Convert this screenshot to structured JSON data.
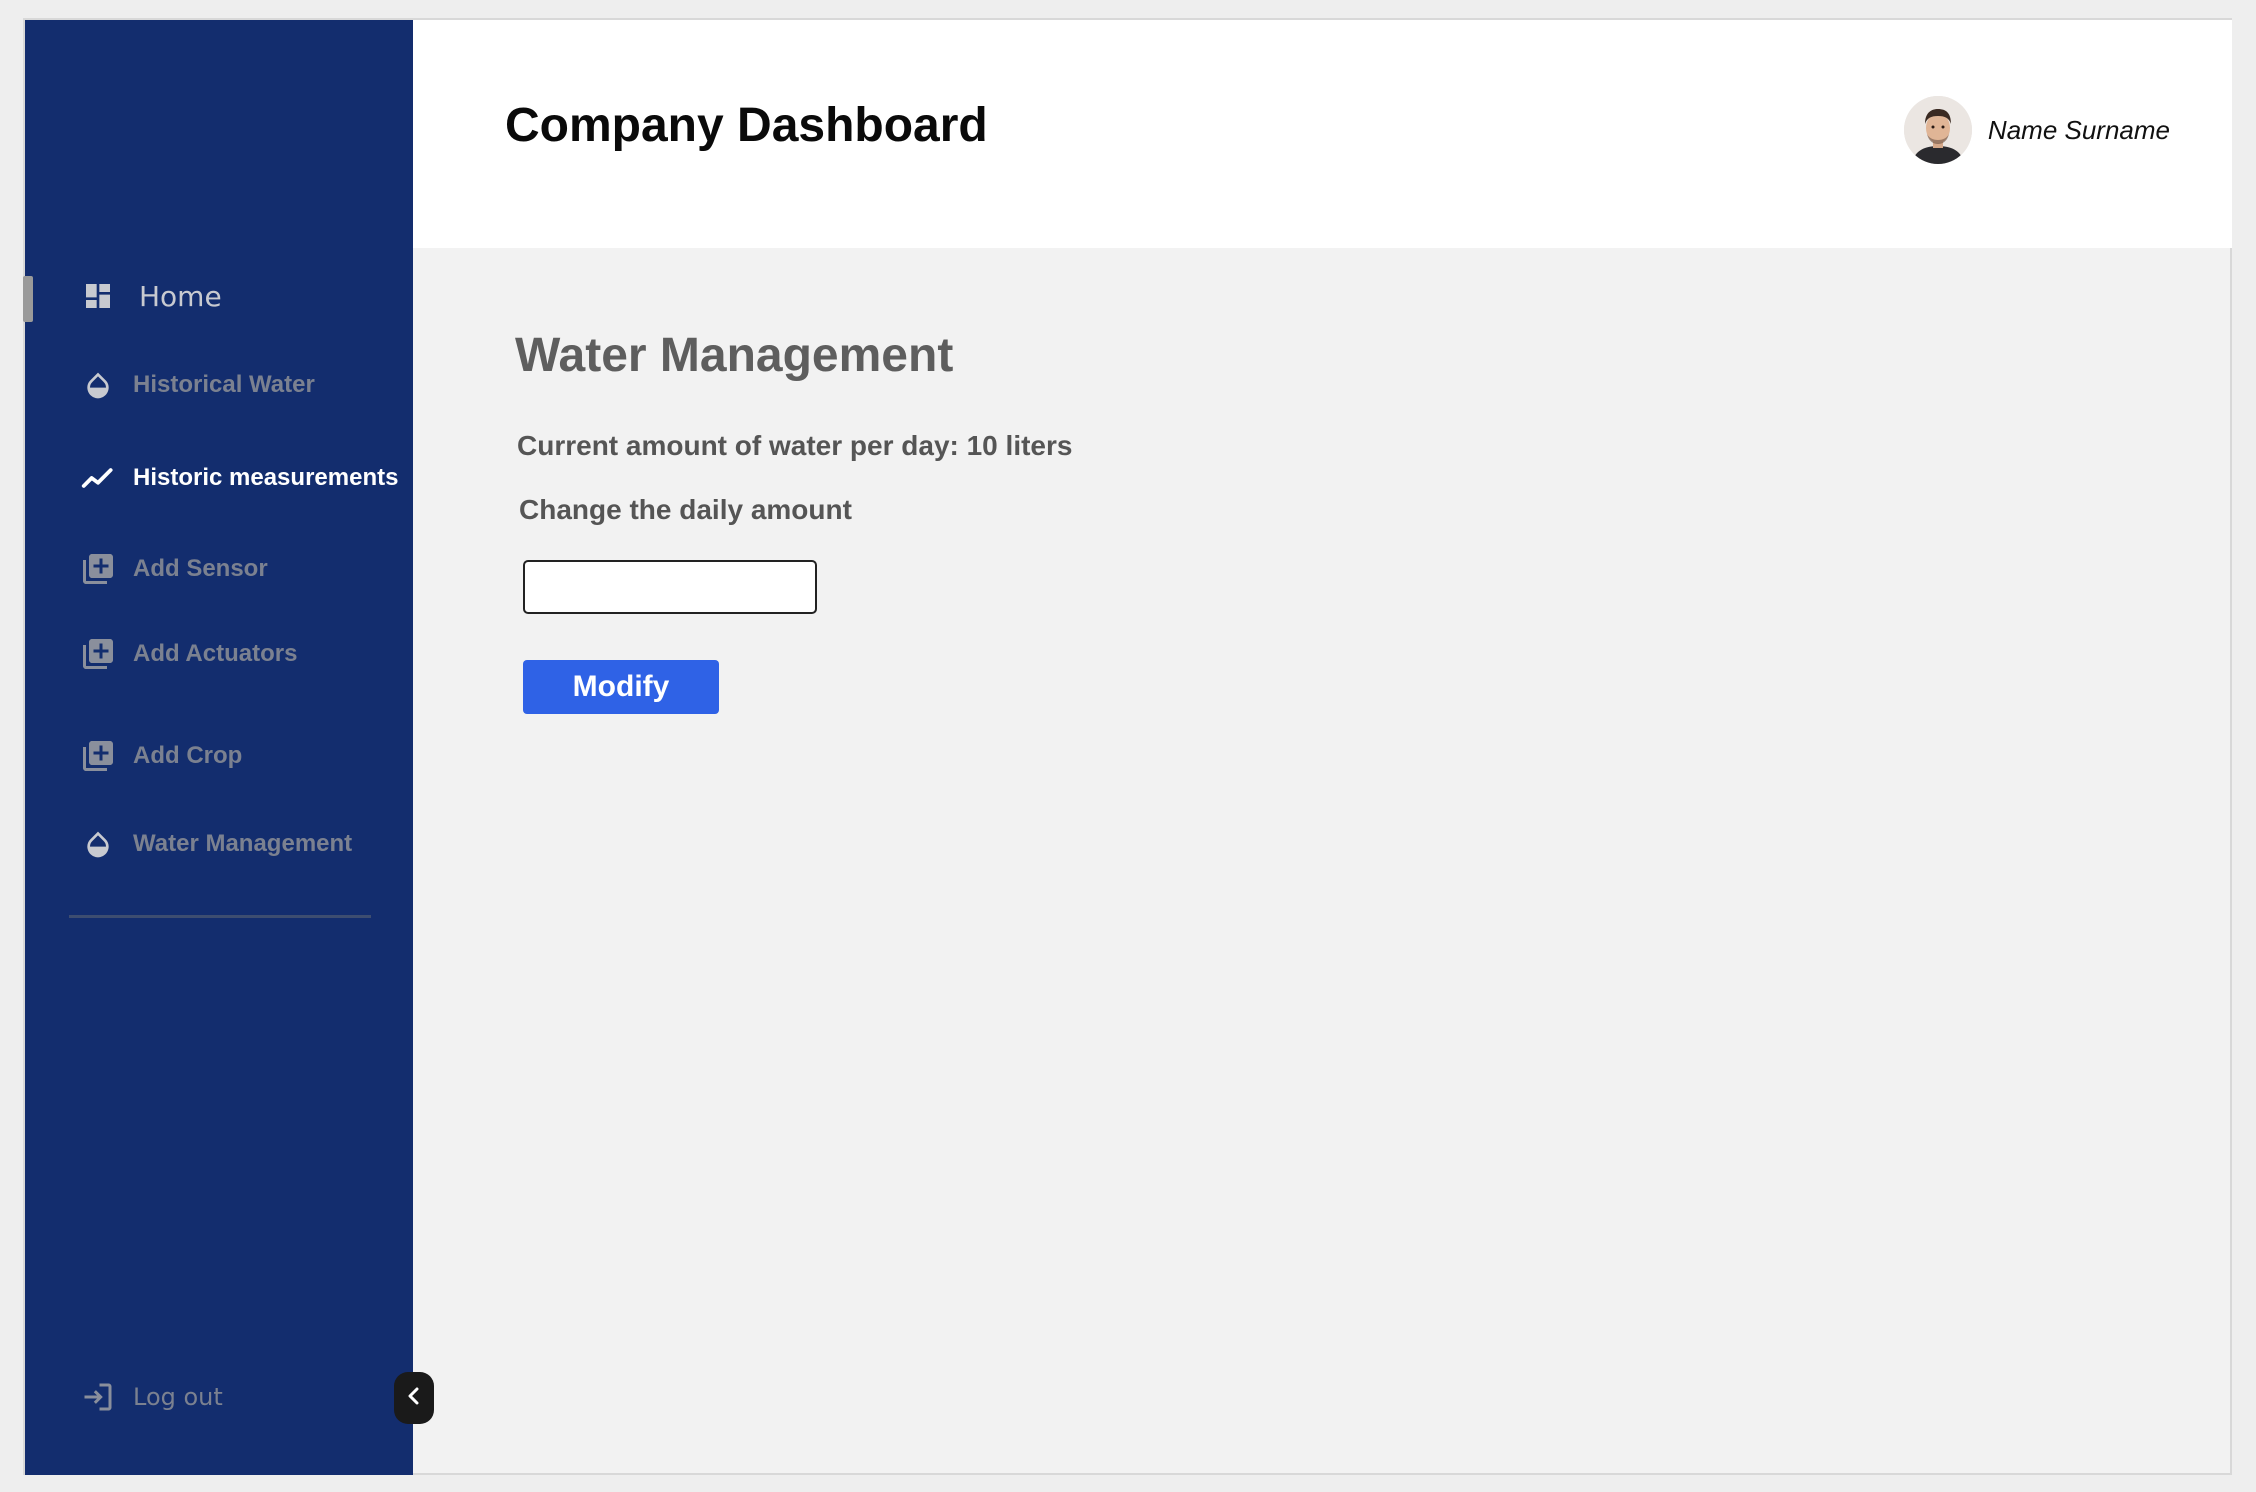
{
  "header": {
    "title": "Company Dashboard",
    "user_name": "Name Surname"
  },
  "sidebar": {
    "items": [
      {
        "label": "Home",
        "icon": "dashboard-icon"
      },
      {
        "label": "Historical Water",
        "icon": "water-drop-icon"
      },
      {
        "label": "Historic measurements",
        "icon": "line-chart-icon"
      },
      {
        "label": "Add Sensor",
        "icon": "library-add-icon"
      },
      {
        "label": "Add Actuators",
        "icon": "library-add-icon"
      },
      {
        "label": "Add Crop",
        "icon": "library-add-icon"
      },
      {
        "label": "Water Management",
        "icon": "water-drop-icon"
      }
    ],
    "logout_label": "Log out",
    "active_item": "Historic measurements"
  },
  "main": {
    "section_title": "Water Management",
    "current_amount": "Current amount of water per day: 10 liters",
    "change_label": "Change the daily amount",
    "input_value": "",
    "modify_label": "Modify"
  },
  "colors": {
    "sidebar_bg": "#132d6e",
    "accent_button": "#2f62e6",
    "content_bg": "#f2f2f2",
    "header_bg": "#ffffff"
  }
}
